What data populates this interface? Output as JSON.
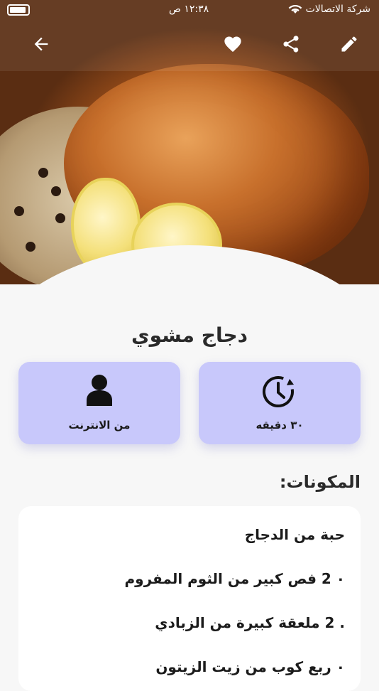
{
  "status_bar": {
    "carrier": "شركة الاتصالات",
    "time": "١٢:٣٨ ص"
  },
  "recipe": {
    "title": "دجاج مشوي",
    "time_label": "٣٠ دقيقه",
    "source_label": "من الانترنت"
  },
  "ingredients": {
    "heading": "المكونات:",
    "lines": [
      "حبة من الدجاج",
      "٠ 2 فص كبير من الثوم المفروم",
      ". 2 ملعقة كبيرة من الزبادي",
      "٠ ربع كوب من زيت الزيتون"
    ]
  },
  "colors": {
    "card_bg": "#c8c8fb",
    "page_bg": "#f7f7f7"
  },
  "icons": {
    "back": "arrow-left-icon",
    "favorite": "heart-icon",
    "share": "share-icon",
    "edit": "pencil-icon",
    "time": "clock-history-icon",
    "source": "person-icon"
  }
}
